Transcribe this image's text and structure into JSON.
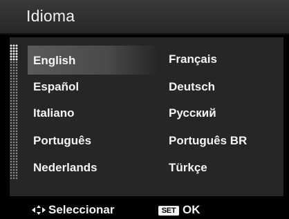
{
  "header": {
    "title": "Idioma"
  },
  "languages": [
    {
      "label": "English",
      "selected": true
    },
    {
      "label": "Français",
      "selected": false
    },
    {
      "label": "Español",
      "selected": false
    },
    {
      "label": "Deutsch",
      "selected": false
    },
    {
      "label": "Italiano",
      "selected": false
    },
    {
      "label": "Русский",
      "selected": false
    },
    {
      "label": "Português",
      "selected": false
    },
    {
      "label": "Português BR",
      "selected": false
    },
    {
      "label": "Nederlands",
      "selected": false
    },
    {
      "label": "Türkçe",
      "selected": false
    }
  ],
  "footer": {
    "navigate_icon": "four-way-arrow-icon",
    "navigate_label": "Seleccionar",
    "set_badge": "SET",
    "ok_label": "OK"
  },
  "colors": {
    "background": "#000000",
    "panel": "#262626",
    "highlight": "#5a5a5a",
    "text": "#f4f4f4"
  }
}
